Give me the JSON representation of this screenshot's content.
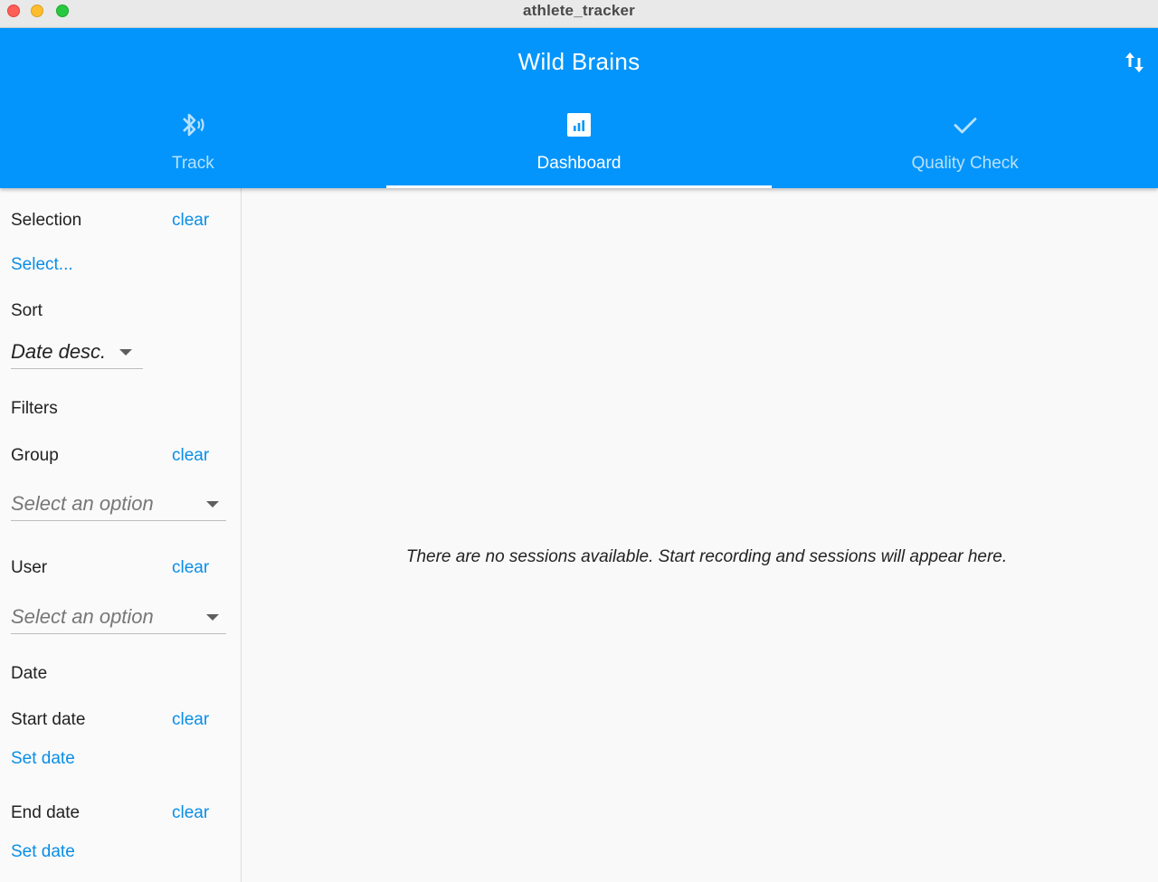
{
  "window": {
    "title": "athlete_tracker"
  },
  "appbar": {
    "title": "Wild Brains",
    "tabs": [
      {
        "label": "Track",
        "icon": "bluetooth-searching-icon",
        "active": false
      },
      {
        "label": "Dashboard",
        "icon": "chart-icon",
        "active": true
      },
      {
        "label": "Quality Check",
        "icon": "check-icon",
        "active": false
      }
    ]
  },
  "sidebar": {
    "selection": {
      "heading": "Selection",
      "clear": "clear",
      "select_link": "Select..."
    },
    "sort": {
      "heading": "Sort",
      "value": "Date desc."
    },
    "filters": {
      "heading": "Filters",
      "group": {
        "label": "Group",
        "clear": "clear",
        "placeholder": "Select an option"
      },
      "user": {
        "label": "User",
        "clear": "clear",
        "placeholder": "Select an option"
      }
    },
    "date": {
      "heading": "Date",
      "start": {
        "label": "Start date",
        "clear": "clear",
        "set_link": "Set date"
      },
      "end": {
        "label": "End date",
        "clear": "clear",
        "set_link": "Set date"
      }
    }
  },
  "main": {
    "empty_message": "There are no sessions available. Start recording and sessions will appear here."
  },
  "colors": {
    "primary": "#0395fb",
    "link": "#0a8ee6",
    "background": "#f9f9f9"
  }
}
